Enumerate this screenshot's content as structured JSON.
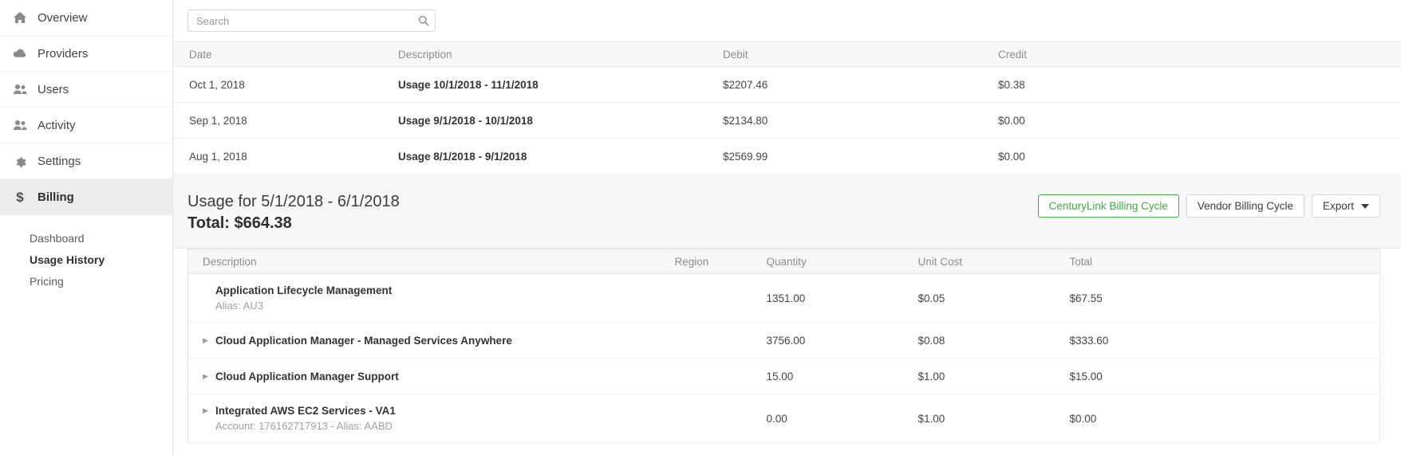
{
  "sidebar": {
    "items": [
      {
        "label": "Overview",
        "icon": "home-icon",
        "active": true
      },
      {
        "label": "Providers",
        "icon": "cloud-icon",
        "active": false
      },
      {
        "label": "Users",
        "icon": "users-icon",
        "active": false
      },
      {
        "label": "Activity",
        "icon": "activity-icon",
        "active": false
      },
      {
        "label": "Settings",
        "icon": "gear-icon",
        "active": false
      },
      {
        "label": "Billing",
        "icon": "dollar-icon",
        "active": true
      }
    ],
    "subitems": [
      {
        "label": "Dashboard",
        "active": false
      },
      {
        "label": "Usage History",
        "active": true
      },
      {
        "label": "Pricing",
        "active": false
      }
    ]
  },
  "search": {
    "value": "",
    "placeholder": "Search",
    "icon": "search-icon"
  },
  "invoice_table": {
    "columns": [
      "Date",
      "Description",
      "Debit",
      "Credit"
    ],
    "rows": [
      {
        "date": "Oct 1, 2018",
        "description": "Usage 10/1/2018 - 11/1/2018",
        "debit": "$2207.46",
        "credit": "$0.38"
      },
      {
        "date": "Sep 1, 2018",
        "description": "Usage 9/1/2018 - 10/1/2018",
        "debit": "$2134.80",
        "credit": "$0.00"
      },
      {
        "date": "Aug 1, 2018",
        "description": "Usage 8/1/2018 - 9/1/2018",
        "debit": "$2569.99",
        "credit": "$0.00"
      }
    ]
  },
  "usage": {
    "title": "Usage for 5/1/2018 - 6/1/2018",
    "total": "Total: $664.38",
    "buttons": {
      "centurylink": "CenturyLink Billing Cycle",
      "vendor": "Vendor Billing Cycle",
      "export": "Export"
    },
    "accent_green": "#46a546"
  },
  "detail_table": {
    "columns": [
      "Description",
      "Region",
      "Quantity",
      "Unit Cost",
      "Total"
    ],
    "rows": [
      {
        "expandable": false,
        "name": "Application Lifecycle Management",
        "sub": "Alias: AU3",
        "region": "",
        "quantity": "1351.00",
        "unit_cost": "$0.05",
        "total": "$67.55"
      },
      {
        "expandable": true,
        "name": "Cloud Application Manager - Managed Services Anywhere",
        "sub": "",
        "region": "",
        "quantity": "3756.00",
        "unit_cost": "$0.08",
        "total": "$333.60"
      },
      {
        "expandable": true,
        "name": "Cloud Application Manager Support",
        "sub": "",
        "region": "",
        "quantity": "15.00",
        "unit_cost": "$1.00",
        "total": "$15.00"
      },
      {
        "expandable": true,
        "name": "Integrated AWS EC2 Services - VA1",
        "sub": "Account: 176162717913 - Alias: AABD",
        "region": "",
        "quantity": "0.00",
        "unit_cost": "$1.00",
        "total": "$0.00"
      }
    ]
  }
}
